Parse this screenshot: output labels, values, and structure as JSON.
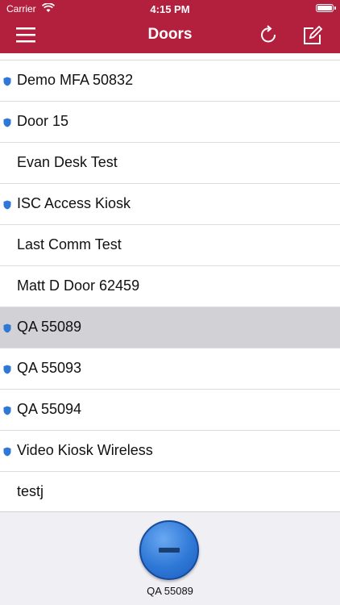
{
  "status_bar": {
    "carrier": "Carrier",
    "time": "4:15 PM"
  },
  "header": {
    "title": "Doors"
  },
  "colors": {
    "brand": "#b3203e",
    "shield": "#2f78d6",
    "selected_row": "#d1d1d6",
    "unlock_button": "#2f78d6"
  },
  "doors": [
    {
      "label": "Demo MFA 50832",
      "secure": true,
      "selected": false
    },
    {
      "label": "Door 15",
      "secure": true,
      "selected": false
    },
    {
      "label": "Evan Desk Test",
      "secure": false,
      "selected": false
    },
    {
      "label": "ISC Access Kiosk",
      "secure": true,
      "selected": false
    },
    {
      "label": "Last Comm Test",
      "secure": false,
      "selected": false
    },
    {
      "label": "Matt D Door 62459",
      "secure": false,
      "selected": false
    },
    {
      "label": "QA 55089",
      "secure": true,
      "selected": true
    },
    {
      "label": "QA 55093",
      "secure": true,
      "selected": false
    },
    {
      "label": "QA 55094",
      "secure": true,
      "selected": false
    },
    {
      "label": "Video Kiosk Wireless",
      "secure": true,
      "selected": false
    },
    {
      "label": "testj",
      "secure": false,
      "selected": false
    }
  ],
  "bottom": {
    "selected_door": "QA 55089"
  },
  "icons": {
    "menu": "hamburger-icon",
    "refresh": "refresh-icon",
    "edit": "edit-icon",
    "secure": "shield-icon",
    "unlock": "unlock-icon"
  }
}
